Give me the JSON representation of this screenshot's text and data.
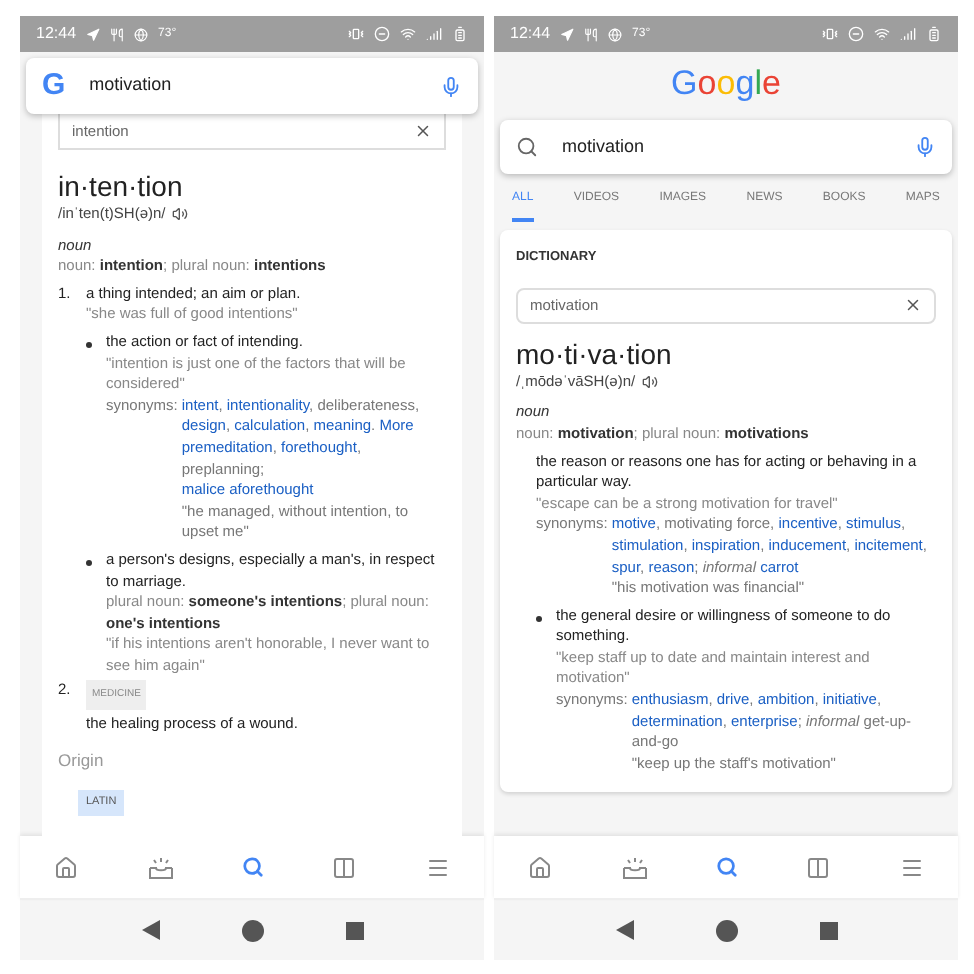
{
  "left_screen": {
    "status_bar": {
      "time": "12:44",
      "temperature": "73°"
    },
    "search_bar": {
      "logo": "G",
      "query": "motivation"
    },
    "dictionary_field": {
      "value": "intention"
    },
    "entry": {
      "headword": "in·ten·tion",
      "pronunciation": "/inˈten(t)SH(ə)n/",
      "part_of_speech": "noun",
      "forms": "noun: **intention**; plural noun: **intentions**",
      "senses": [
        {
          "number": "1.",
          "text": "a thing intended; an aim or plan.",
          "example": "\"she was full of good intentions\"",
          "children": [
            {
              "text": "the action or fact of intending.",
              "example": "\"intention is just one of the factors that will be considered\"",
              "synonyms_label": "synonyms:",
              "synonyms": [
                {
                  "text": "intent",
                  "kind": "link"
                },
                {
                  "text": ", ",
                  "kind": "plain"
                },
                {
                  "text": "intentionality",
                  "kind": "link"
                },
                {
                  "text": ", deliberateness, ",
                  "kind": "plain"
                },
                {
                  "text": "design",
                  "kind": "link"
                },
                {
                  "text": ", ",
                  "kind": "plain"
                },
                {
                  "text": "calculation",
                  "kind": "link"
                },
                {
                  "text": ", ",
                  "kind": "plain"
                },
                {
                  "text": "meaning",
                  "kind": "link"
                },
                {
                  "text": ".  ",
                  "kind": "plain"
                },
                {
                  "text": "More",
                  "kind": "link"
                },
                {
                  "text": "premeditation",
                  "kind": "link",
                  "new_line": true
                },
                {
                  "text": ", ",
                  "kind": "plain"
                },
                {
                  "text": "forethought",
                  "kind": "link"
                },
                {
                  "text": ", preplanning;",
                  "kind": "plain"
                },
                {
                  "text": "malice aforethought",
                  "kind": "link",
                  "new_line": true
                }
              ],
              "synonym_example": "\"he managed, without intention, to upset me\""
            },
            {
              "text": "a person's designs, especially a man's, in respect to marriage.",
              "forms": "plural noun: **someone's intentions**; plural noun: **one's intentions**",
              "example": "\"if his intentions aren't honorable, I never want to see him again\""
            }
          ]
        },
        {
          "number": "2.",
          "label": "MEDICINE",
          "text": "the healing process of a wound."
        }
      ],
      "origin": {
        "heading": "Origin",
        "badge": "LATIN"
      }
    },
    "bottom_nav": [
      {
        "selected": false
      },
      {
        "selected": false
      },
      {
        "selected": true
      },
      {
        "selected": false
      },
      {
        "selected": false
      }
    ]
  },
  "right_screen": {
    "status_bar": {
      "time": "12:44",
      "temperature": "73°"
    },
    "logo": "Google",
    "search_bar": {
      "query": "motivation"
    },
    "tabs": [
      {
        "label": "ALL",
        "selected": true
      },
      {
        "label": "VIDEOS",
        "selected": false
      },
      {
        "label": "IMAGES",
        "selected": false
      },
      {
        "label": "NEWS",
        "selected": false
      },
      {
        "label": "BOOKS",
        "selected": false
      },
      {
        "label": "MAPS",
        "selected": false
      }
    ],
    "card_title": "DICTIONARY",
    "dictionary_field": {
      "value": "motivation"
    },
    "entry": {
      "headword": "mo·ti·va·tion",
      "pronunciation": "/ˌmōdəˈvāSH(ə)n/",
      "part_of_speech": "noun",
      "forms": "noun: **motivation**; plural noun: **motivations**",
      "senses": [
        {
          "text": "the reason or reasons one has for acting or behaving in a particular way.",
          "example": "\"escape can be a strong motivation for travel\"",
          "synonyms_label": "synonyms:",
          "synonyms": [
            {
              "text": "motive",
              "kind": "link"
            },
            {
              "text": ", motivating force, ",
              "kind": "plain"
            },
            {
              "text": "incentive",
              "kind": "link"
            },
            {
              "text": ", ",
              "kind": "plain"
            },
            {
              "text": "stimulus",
              "kind": "link"
            },
            {
              "text": ", ",
              "kind": "plain"
            },
            {
              "text": "stimulation",
              "kind": "link"
            },
            {
              "text": ", ",
              "kind": "plain"
            },
            {
              "text": "inspiration",
              "kind": "link"
            },
            {
              "text": ", ",
              "kind": "plain"
            },
            {
              "text": "inducement",
              "kind": "link"
            },
            {
              "text": ", ",
              "kind": "plain"
            },
            {
              "text": "incitement",
              "kind": "link"
            },
            {
              "text": ", ",
              "kind": "plain"
            },
            {
              "text": "spur",
              "kind": "link"
            },
            {
              "text": ", ",
              "kind": "plain"
            },
            {
              "text": "reason",
              "kind": "link"
            },
            {
              "text": "; ",
              "kind": "plain"
            },
            {
              "text": "informal ",
              "kind": "informal"
            },
            {
              "text": "carrot",
              "kind": "link"
            }
          ],
          "synonym_example": "\"his motivation was financial\"",
          "children": [
            {
              "text": "the general desire or willingness of someone to do something.",
              "example": "\"keep staff up to date and maintain interest and motivation\"",
              "synonyms_label": "synonyms:",
              "synonyms": [
                {
                  "text": "enthusiasm",
                  "kind": "link"
                },
                {
                  "text": ", ",
                  "kind": "plain"
                },
                {
                  "text": "drive",
                  "kind": "link"
                },
                {
                  "text": ", ",
                  "kind": "plain"
                },
                {
                  "text": "ambition",
                  "kind": "link"
                },
                {
                  "text": ", ",
                  "kind": "plain"
                },
                {
                  "text": "initiative",
                  "kind": "link"
                },
                {
                  "text": ", ",
                  "kind": "plain"
                },
                {
                  "text": "determination",
                  "kind": "link"
                },
                {
                  "text": ", ",
                  "kind": "plain"
                },
                {
                  "text": "enterprise",
                  "kind": "link"
                },
                {
                  "text": "; ",
                  "kind": "plain"
                },
                {
                  "text": "informal",
                  "kind": "informal"
                },
                {
                  "text": " get-up-and-go",
                  "kind": "plain"
                }
              ],
              "synonym_example": "\"keep up the staff's motivation\""
            }
          ]
        }
      ]
    },
    "bottom_nav": [
      {
        "selected": false
      },
      {
        "selected": false
      },
      {
        "selected": true
      },
      {
        "selected": false
      },
      {
        "selected": false
      }
    ]
  }
}
